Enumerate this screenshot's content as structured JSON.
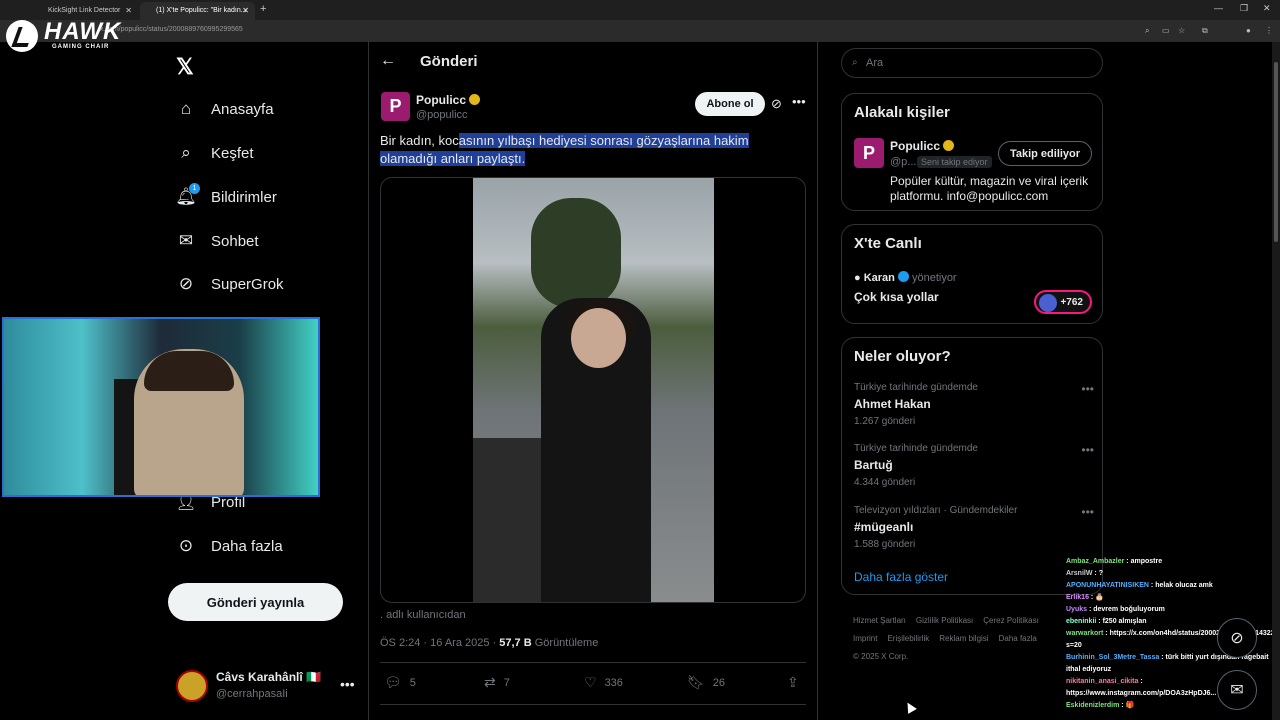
{
  "browser": {
    "tabs": [
      {
        "title": "KickSight Link Detector"
      },
      {
        "title": "(1) X'te Populicc: \"Bir kadın..."
      }
    ],
    "url": "x.com/populicc/status/2000889760995299565"
  },
  "overlay": {
    "brand": "HAWK",
    "brand_sub": "GAMING CHAIR"
  },
  "nav": {
    "items": [
      {
        "label": "Anasayfa",
        "icon": "home-icon"
      },
      {
        "label": "Keşfet",
        "icon": "search-icon"
      },
      {
        "label": "Bildirimler",
        "icon": "bell-icon",
        "badge": "1"
      },
      {
        "label": "Sohbet",
        "icon": "envelope-icon"
      },
      {
        "label": "SuperGrok",
        "icon": "grok-icon"
      },
      {
        "label": "Profil",
        "icon": "person-icon"
      },
      {
        "label": "Daha fazla",
        "icon": "more-circle-icon"
      }
    ],
    "post_button": "Gönderi yayınla",
    "user": {
      "name": "Câvs Karahânlî 🇮🇹",
      "handle": "@cerrahpasaIi"
    }
  },
  "post": {
    "header_title": "Gönderi",
    "author_name": "Populicc",
    "author_handle": "@populicc",
    "subscribe_label": "Abone ol",
    "text_plain": "Bir kadın, koc",
    "text_highlight": "asının yılbaşı hediyesi sonrası gözyaşlarına hakim olamadığı anları paylaştı.",
    "caption": ". adlı kullanıcıdan",
    "time": "ÖS 2:24 · 16 Ara 2025 · ",
    "views": "57,7 B",
    "views_label": " Görüntüleme",
    "replies": "5",
    "reposts": "7",
    "likes": "336",
    "bookmarks": "26"
  },
  "sidebar": {
    "search_placeholder": "Ara",
    "relevant_title": "Alakalı kişiler",
    "relevant": {
      "name": "Populicc",
      "handle": "@p...",
      "follows_you": "Seni takip ediyor",
      "button": "Takip ediliyor",
      "bio": "Popüler kültür, magazin ve viral içerik platformu. info@populicc.com"
    },
    "live_title": "X'te Canlı",
    "live": {
      "host": "Karan",
      "role": " yönetiyor",
      "title": "Çok kısa yollar",
      "count": "+762"
    },
    "trends_title": "Neler oluyor?",
    "trends": [
      {
        "context": "Türkiye tarihinde gündemde",
        "topic": "Ahmet Hakan",
        "count": "1.267 gönderi"
      },
      {
        "context": "Türkiye tarihinde gündemde",
        "topic": "Bartuğ",
        "count": "4.344 gönderi"
      },
      {
        "context": "Televizyon yıldızları · Gündemdekiler",
        "topic": "#mügeanlı",
        "count": "1.588 gönderi"
      }
    ],
    "show_more": "Daha fazla göster",
    "footer": [
      "Hizmet Şartları",
      "Gizlilik Politikası",
      "Çerez Politikası",
      "Imprint",
      "Erişilebilirlik",
      "Reklam bilgisi",
      "Daha fazla",
      "© 2025 X Corp."
    ]
  },
  "chat": [
    {
      "user": "Ambaz_Ambazler",
      "msg": "ampostre",
      "color": "#7ee37e"
    },
    {
      "user": "ArsnilW",
      "msg": "?",
      "color": "#cfcfcf"
    },
    {
      "user": "APONUNHAYATINISIKEN",
      "msg": "helak olucaz amk",
      "color": "#4fb0ff"
    },
    {
      "user": "Erlik16",
      "msg": "🎂",
      "color": "#d98bff"
    },
    {
      "user": "Uyuks",
      "msg": "devrem boğuluyorum",
      "color": "#c58bff"
    },
    {
      "user": "ebeninkii",
      "msg": "f250 almışlan",
      "color": "#8affd2"
    },
    {
      "user": "warwarkort",
      "msg": "https://x.com/on4hd/status/2000234297467314322?s=20",
      "color": "#7ee37e"
    },
    {
      "user": "Burhinin_Sol_3Metre_Tassa",
      "msg": "türk bitti yurt dışından ragebait ithal ediyoruz",
      "color": "#4fb0ff"
    },
    {
      "user": "nikitanin_anasi_cikita",
      "msg": "https://www.instagram.com/p/DOA3zHpDJ6...",
      "color": "#ff7aa2"
    },
    {
      "user": "Eskidenizlerdim",
      "msg": "🎁",
      "color": "#7ee37e"
    }
  ]
}
